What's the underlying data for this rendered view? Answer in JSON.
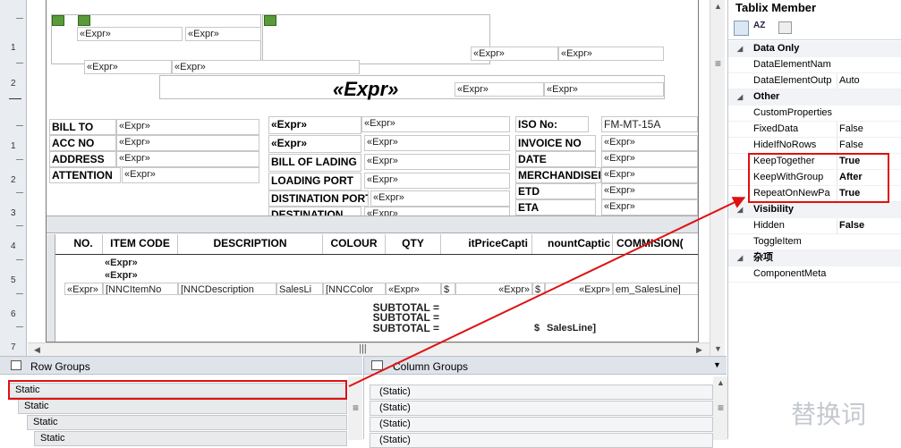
{
  "ruler": {
    "marks": [
      "1",
      "2",
      "1",
      "2",
      "3",
      "4",
      "5",
      "6",
      "7"
    ]
  },
  "report": {
    "expr": "«Expr»",
    "big_expr": "«Expr»",
    "info_labels": {
      "bill_to": "BILL TO",
      "acc_no": "ACC NO",
      "address": "ADDRESS",
      "attention": "ATTENTION",
      "expr_bold": "«Expr»",
      "bill_of_lading": "BILL OF LADING",
      "loading_port": "LOADING PORT",
      "destination_port": "DISTINATION PORT",
      "destination": "DESTINATION",
      "iso_no": "ISO No:",
      "iso_value": "FM-MT-15A",
      "invoice_no": "INVOICE NO",
      "date": "DATE",
      "merchandiser": "MERCHANDISER",
      "etd": "ETD",
      "eta": "ETA"
    },
    "table_headers": [
      "NO.",
      "ITEM CODE",
      "DESCRIPTION",
      "COLOUR",
      "QTY",
      "itPriceCapti",
      "nountCaptic",
      "COMMISION("
    ],
    "detail_cells": [
      "«Expr»",
      "[NNCItemNo",
      "[NNCDescription",
      "SalesLi",
      "[NNCColor",
      "«Expr»",
      "$",
      "«Expr»",
      "$",
      "«Expr»",
      "em_SalesLine]"
    ],
    "expr_row": "«Expr»",
    "subtotal": "SUBTOTAL =",
    "dollar": "$",
    "salesline": "SalesLine]"
  },
  "row_groups": {
    "title": "Row Groups",
    "items": [
      "Static",
      "Static",
      "Static",
      "Static"
    ]
  },
  "column_groups": {
    "title": "Column Groups",
    "items": [
      "(Static)",
      "(Static)",
      "(Static)",
      "(Static)"
    ]
  },
  "properties": {
    "title": "Tablix Member",
    "categories": [
      {
        "name": "Data Only",
        "rows": [
          {
            "name": "DataElementNam",
            "value": ""
          },
          {
            "name": "DataElementOutp",
            "value": "Auto"
          }
        ]
      },
      {
        "name": "Other",
        "rows": [
          {
            "name": "CustomProperties",
            "value": ""
          },
          {
            "name": "FixedData",
            "value": "False"
          },
          {
            "name": "HideIfNoRows",
            "value": "False"
          },
          {
            "name": "KeepTogether",
            "value": "True"
          },
          {
            "name": "KeepWithGroup",
            "value": "After"
          },
          {
            "name": "RepeatOnNewPa",
            "value": "True"
          }
        ]
      },
      {
        "name": "Visibility",
        "rows": [
          {
            "name": "Hidden",
            "value": "False"
          },
          {
            "name": "ToggleItem",
            "value": ""
          }
        ]
      },
      {
        "name": "杂项",
        "rows": [
          {
            "name": "ComponentMeta",
            "value": ""
          }
        ]
      }
    ]
  },
  "watermark": "替换词",
  "colors": {
    "highlight": "#e01010",
    "panel": "#dfe3ea"
  }
}
